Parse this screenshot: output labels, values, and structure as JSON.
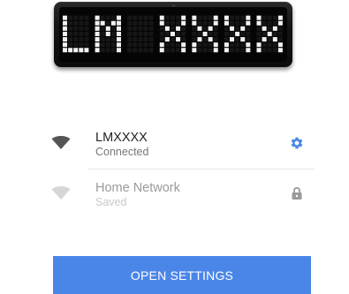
{
  "device": {
    "display_text": "LM XXXX"
  },
  "networks": [
    {
      "name": "LMXXXX",
      "status": "Connected",
      "action_icon": "gear-icon",
      "icon_color": "#555555",
      "action_color": "#4a86e8"
    },
    {
      "name": "Home Network",
      "status": "Saved",
      "action_icon": "lock-icon",
      "icon_color": "#d6d6d6",
      "action_color": "#9a9a9a"
    }
  ],
  "button": {
    "label": "OPEN SETTINGS",
    "color": "#4a86e8"
  }
}
